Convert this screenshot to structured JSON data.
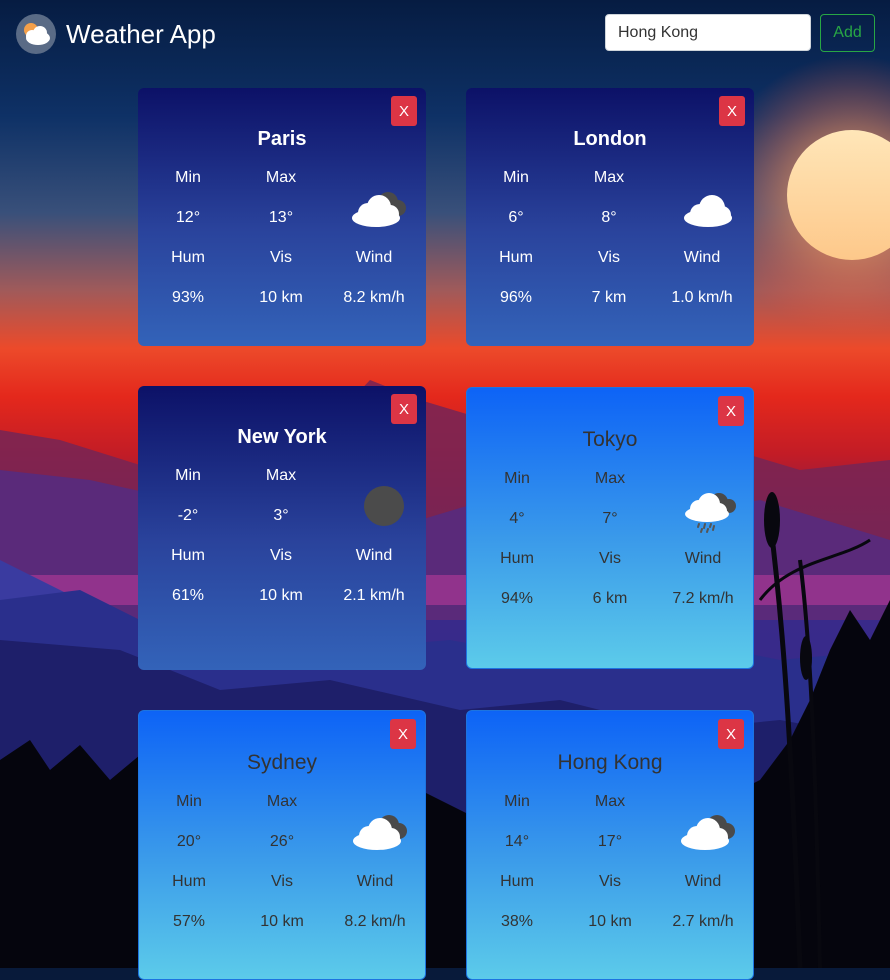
{
  "header": {
    "title": "Weather App",
    "search_value": "Hong Kong",
    "add_label": "Add"
  },
  "labels": {
    "min": "Min",
    "max": "Max",
    "hum": "Hum",
    "vis": "Vis",
    "wind": "Wind",
    "close": "X"
  },
  "cards": [
    {
      "city": "Paris",
      "min": "12°",
      "max": "13°",
      "hum": "93%",
      "vis": "10 km",
      "wind": "8.2 km/h",
      "icon": "partly-cloudy-icon",
      "theme": "night"
    },
    {
      "city": "London",
      "min": "6°",
      "max": "8°",
      "hum": "96%",
      "vis": "7 km",
      "wind": "1.0 km/h",
      "icon": "cloud-icon",
      "theme": "night"
    },
    {
      "city": "New York",
      "min": "-2°",
      "max": "3°",
      "hum": "61%",
      "vis": "10 km",
      "wind": "2.1 km/h",
      "icon": "moon-icon",
      "theme": "night"
    },
    {
      "city": "Tokyo",
      "min": "4°",
      "max": "7°",
      "hum": "94%",
      "vis": "6 km",
      "wind": "7.2 km/h",
      "icon": "rain-cloud-icon",
      "theme": "day"
    },
    {
      "city": "Sydney",
      "min": "20°",
      "max": "26°",
      "hum": "57%",
      "vis": "10 km",
      "wind": "8.2 km/h",
      "icon": "partly-cloudy-icon",
      "theme": "day"
    },
    {
      "city": "Hong Kong",
      "min": "14°",
      "max": "17°",
      "hum": "38%",
      "vis": "10 km",
      "wind": "2.7 km/h",
      "icon": "partly-cloudy-icon",
      "theme": "day"
    }
  ],
  "colors": {
    "close_button": "#dc3545",
    "add_button": "#28a745",
    "night_card_top": "#0c1167",
    "day_card_top": "#0d63f6"
  }
}
